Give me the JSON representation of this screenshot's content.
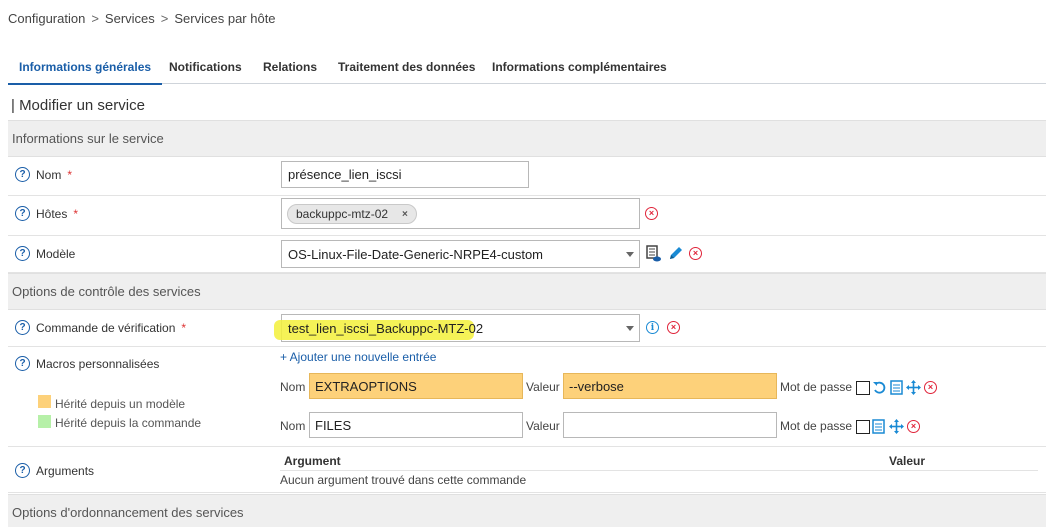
{
  "breadcrumb": {
    "items": [
      "Configuration",
      "Services",
      "Services par hôte"
    ],
    "separator": ">"
  },
  "tabs": [
    "Informations générales",
    "Notifications",
    "Relations",
    "Traitement des données",
    "Informations complémentaires"
  ],
  "form_title": "| Modifier un service",
  "sections": {
    "service_info": "Informations sur le service",
    "control_options": "Options de contrôle des services",
    "scheduling": "Options d'ordonnancement des services"
  },
  "fields": {
    "name": {
      "label": "Nom",
      "required": "*",
      "value": "présence_lien_iscsi"
    },
    "hosts": {
      "label": "Hôtes",
      "required": "*",
      "chip": "backuppc-mtz-02",
      "chip_remove": "×"
    },
    "template": {
      "label": "Modèle",
      "value": "OS-Linux-File-Date-Generic-NRPE4-custom"
    },
    "check_command": {
      "label": "Commande de vérification",
      "required": "*",
      "value": "test_lien_iscsi_Backuppc-MTZ-02"
    },
    "macros": {
      "label": "Macros personnalisées",
      "add_entry": "+ Ajouter une nouvelle entrée",
      "legend_template": "Hérité depuis un modèle",
      "legend_command": "Hérité depuis la commande",
      "name_label": "Nom",
      "value_label": "Valeur",
      "password_label": "Mot de passe",
      "rows": [
        {
          "name": "EXTRAOPTIONS",
          "value": "--verbose",
          "inherited": true
        },
        {
          "name": "FILES",
          "value": "",
          "inherited": false
        }
      ]
    },
    "arguments": {
      "label": "Arguments",
      "col_argument": "Argument",
      "col_value": "Valeur",
      "empty": "Aucun argument trouvé dans cette commande"
    }
  },
  "icons": {
    "help": "?",
    "remove": "×",
    "info": "i"
  },
  "colors": {
    "accent": "#1a5ea8",
    "remove": "#e0243a",
    "inherited_template": "#fdd17a",
    "inherited_command": "#b6f0a8",
    "highlight": "#f3f03a"
  }
}
